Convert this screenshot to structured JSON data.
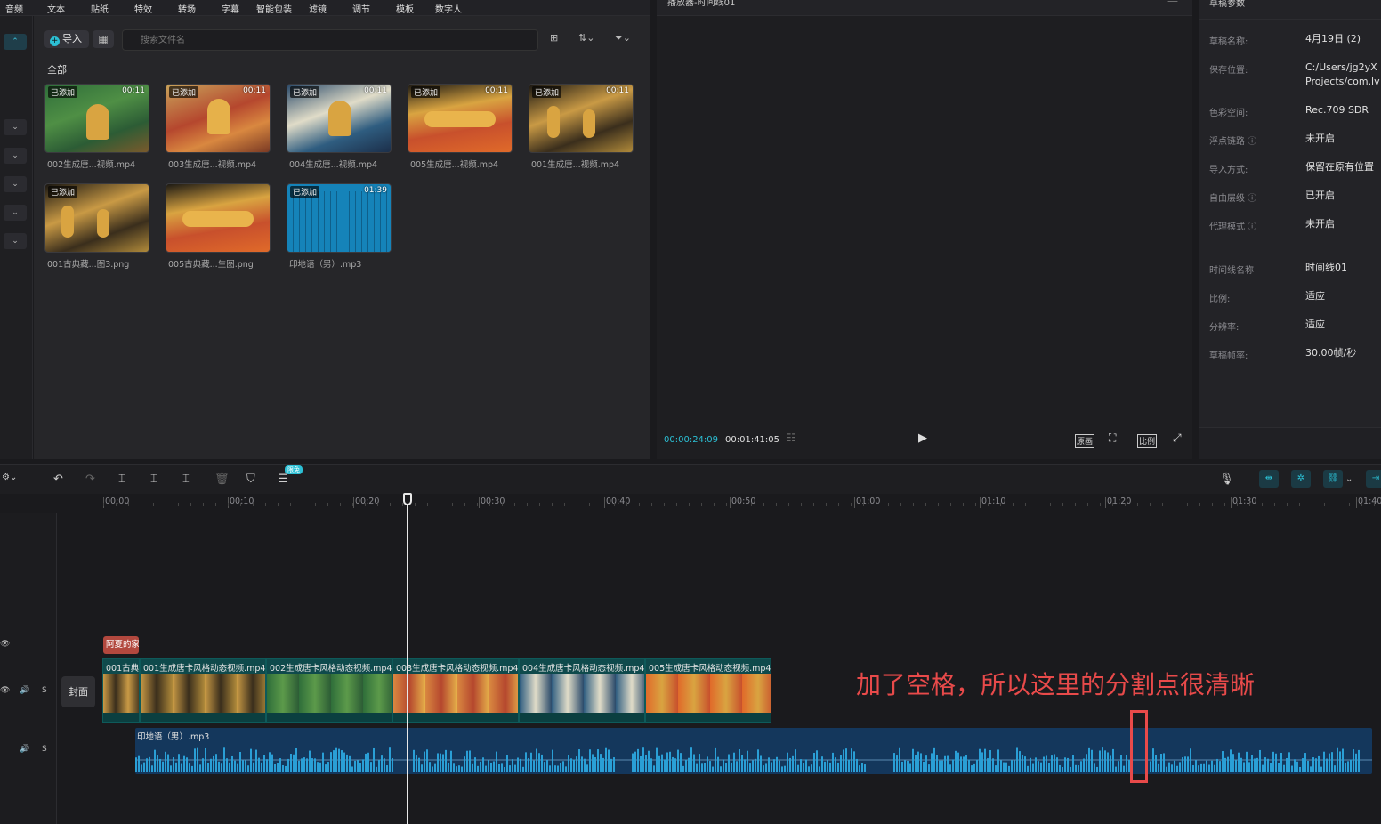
{
  "menubar": {
    "items": [
      "音频",
      "文本",
      "贴纸",
      "特效",
      "转场",
      "字幕",
      "智能包装",
      "滤镜",
      "调节",
      "模板",
      "数字人"
    ]
  },
  "media": {
    "import_label": "导入",
    "search_placeholder": "搜索文件名",
    "section_label": "全部",
    "items": [
      {
        "caption": "002生成唐...视频.mp4",
        "badge": "已添加",
        "duration": "00:11"
      },
      {
        "caption": "003生成唐...视频.mp4",
        "badge": "已添加",
        "duration": "00:11"
      },
      {
        "caption": "004生成唐...视频.mp4",
        "badge": "已添加",
        "duration": "00:11"
      },
      {
        "caption": "005生成唐...视频.mp4",
        "badge": "已添加",
        "duration": "00:11"
      },
      {
        "caption": "001生成唐...视频.mp4",
        "badge": "已添加",
        "duration": "00:11"
      },
      {
        "caption": "001古典藏...图3.png",
        "badge": "已添加",
        "duration": ""
      },
      {
        "caption": "005古典藏...生图.png",
        "badge": "",
        "duration": ""
      },
      {
        "caption": "印地语（男）.mp3",
        "badge": "已添加",
        "duration": "01:39"
      }
    ]
  },
  "player": {
    "title": "播放器-时间线01",
    "current_time": "00:00:24:09",
    "total_time": "00:01:41:05",
    "btn_original": "原画",
    "btn_ratio": "比例"
  },
  "props": {
    "title": "草稿参数",
    "rows": [
      {
        "label": "草稿名称:",
        "value": "4月19日 (2)"
      },
      {
        "label": "保存位置:",
        "value": "C:/Users/jg2yX",
        "value2": "Projects/com.lv"
      },
      {
        "label": "色彩空间:",
        "value": "Rec.709 SDR"
      },
      {
        "label": "浮点链路 ⓘ",
        "value": "未开启"
      },
      {
        "label": "导入方式:",
        "value": "保留在原有位置"
      },
      {
        "label": "自由层级 ⓘ",
        "value": "已开启"
      },
      {
        "label": "代理模式 ⓘ",
        "value": "未开启"
      }
    ],
    "rows2": [
      {
        "label": "时间线名称",
        "value": "时间线01"
      },
      {
        "label": "比例:",
        "value": "适应"
      },
      {
        "label": "分辨率:",
        "value": "适应"
      },
      {
        "label": "草稿帧率:",
        "value": "30.00帧/秒"
      }
    ]
  },
  "toolbar": {
    "free_badge": "限免"
  },
  "ruler": {
    "labels": [
      "00:00",
      "00:10",
      "00:20",
      "00:30",
      "00:40",
      "00:50",
      "01:00",
      "01:10",
      "01:20",
      "01:30",
      "01:40"
    ]
  },
  "timeline": {
    "cover_label": "封面",
    "text_clip": "阿夏的家",
    "video_clips": [
      {
        "label": "001古典"
      },
      {
        "label": "001生成唐卡风格动态视频.mp4"
      },
      {
        "label": "002生成唐卡风格动态视频.mp4"
      },
      {
        "label": "003生成唐卡风格动态视频.mp4"
      },
      {
        "label": "004生成唐卡风格动态视频.mp4"
      },
      {
        "label": "005生成唐卡风格动态视频.mp4"
      }
    ],
    "audio_clip": "印地语（男）.mp3",
    "track_s": "S"
  },
  "annotation": "加了空格，所以这里的分割点很清晰",
  "colors": {
    "accent": "#2cc0d5",
    "annotation": "#e84a4a",
    "text_clip": "#b2483e",
    "audio_bg": "#14375c",
    "video_bg": "#0f4a4c"
  }
}
